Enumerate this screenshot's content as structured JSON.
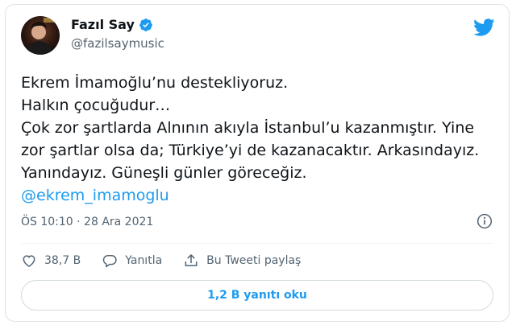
{
  "author": {
    "display_name": "Fazıl Say",
    "handle": "@fazilsaymusic",
    "verified": true
  },
  "tweet": {
    "lines": [
      "Ekrem İmamoğlu’nu destekliyoruz.",
      "Halkın çocuğudur…",
      "Çok zor şartlarda Alnının akıyla İstanbul’u kazanmıştır. Yine",
      "zor şartlar olsa da; Türkiye’yi de kazanacaktır. Arkasındayız.",
      "Yanındayız. Güneşli günler göreceğiz."
    ],
    "mention": "@ekrem_imamoglu",
    "timestamp": "ÖS 10:10 · 28 Ara 2021"
  },
  "actions": {
    "likes": "38,7 B",
    "reply_label": "Yanıtla",
    "share_label": "Bu Tweeti paylaş"
  },
  "read_replies_label": "1,2 B yanıtı oku",
  "colors": {
    "accent": "#1d9bf0",
    "text": "#0f1419",
    "secondary": "#536471"
  }
}
